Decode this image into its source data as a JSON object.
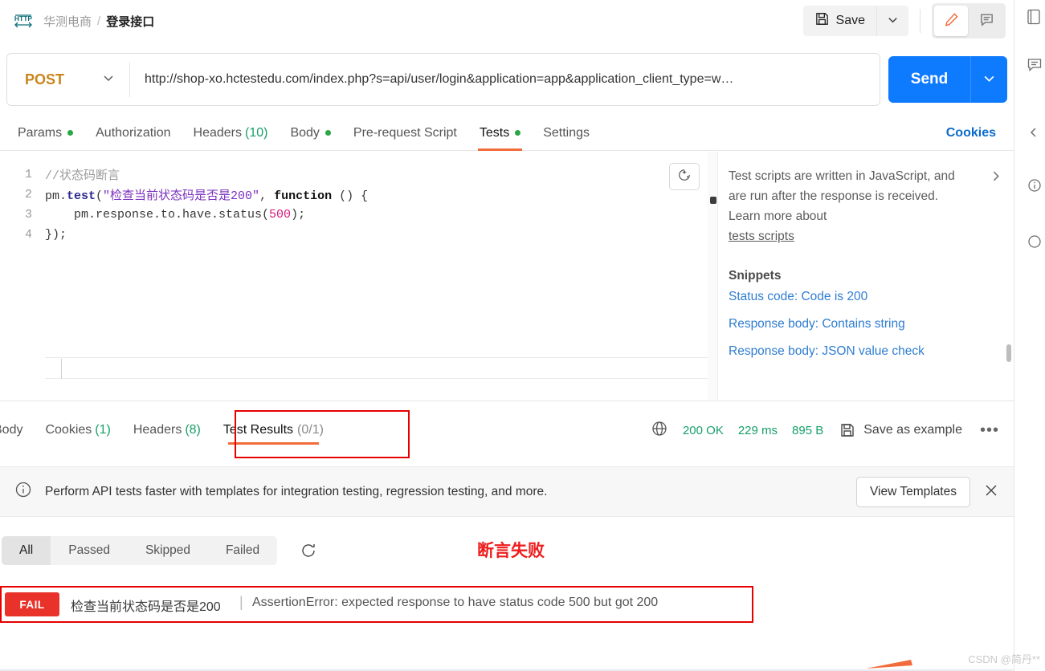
{
  "breadcrumb": {
    "protocol_badge": "HTTP",
    "parent": "华测电商",
    "separator": "/",
    "current": "登录接口"
  },
  "toolbar": {
    "save_label": "Save",
    "save_icon": "floppy-disk-icon",
    "save_caret_icon": "chevron-down-icon",
    "edit_icon": "pencil-icon",
    "comment_icon": "comment-icon"
  },
  "url_bar": {
    "method": "POST",
    "method_caret_icon": "chevron-down-icon",
    "url": "http://shop-xo.hctestedu.com/index.php?s=api/user/login&application=app&application_client_type=w…",
    "send_label": "Send",
    "send_caret_icon": "chevron-down-icon"
  },
  "request_tabs": {
    "items": [
      {
        "label": "Params",
        "dot": true,
        "count": "",
        "active": false
      },
      {
        "label": "Authorization",
        "dot": false,
        "count": "",
        "active": false
      },
      {
        "label": "Headers",
        "dot": false,
        "count": "(10)",
        "active": false
      },
      {
        "label": "Body",
        "dot": true,
        "count": "",
        "active": false
      },
      {
        "label": "Pre-request Script",
        "dot": false,
        "count": "",
        "active": false
      },
      {
        "label": "Tests",
        "dot": true,
        "count": "",
        "active": true
      },
      {
        "label": "Settings",
        "dot": false,
        "count": "",
        "active": false
      }
    ],
    "cookies_link": "Cookies"
  },
  "editor": {
    "postbot_icon": "postbot-magic-icon",
    "lines": [
      {
        "num": "1"
      },
      {
        "num": "2"
      },
      {
        "num": "3"
      },
      {
        "num": "4"
      }
    ],
    "line1_comment": "//状态码断言",
    "line2_a": "pm.",
    "line2_b": "test",
    "line2_c": "(",
    "line2_d": "\"检查当前状态码是否是200\"",
    "line2_e": ", ",
    "line2_f": "function",
    "line2_g": " () {",
    "line3_a": "    pm.response.to.have.status(",
    "line3_b": "500",
    "line3_c": ");",
    "line4": "});"
  },
  "docs": {
    "paragraph": "Test scripts are written in JavaScript, and are run after the response is received. Learn more about",
    "link": "tests scripts",
    "chevron_icon": "chevron-right-icon",
    "snippets_heading": "Snippets",
    "snippets": [
      "Status code: Code is 200",
      "Response body: Contains string",
      "Response body: JSON value check"
    ]
  },
  "response": {
    "tabs": [
      {
        "label": "Body",
        "count": "",
        "active": false
      },
      {
        "label": "Cookies",
        "count": "(1)",
        "active": false
      },
      {
        "label": "Headers",
        "count": "(8)",
        "active": false
      },
      {
        "label": "Test Results",
        "count": "(0/1)",
        "active": true
      }
    ],
    "globe_icon": "globe-icon",
    "status": "200 OK",
    "time": "229 ms",
    "size": "895 B",
    "save_example_icon": "floppy-disk-icon",
    "save_example": "Save as example",
    "more_icon": "ellipsis-icon"
  },
  "banner": {
    "info_icon": "info-circle-icon",
    "text": "Perform API tests faster with templates for integration testing, regression testing, and more.",
    "button": "View Templates",
    "close_icon": "close-icon"
  },
  "filters": {
    "items": [
      {
        "label": "All",
        "active": true
      },
      {
        "label": "Passed",
        "active": false
      },
      {
        "label": "Skipped",
        "active": false
      },
      {
        "label": "Failed",
        "active": false
      }
    ],
    "refresh_icon": "refresh-icon",
    "annotation": "断言失败"
  },
  "result_row": {
    "badge": "FAIL",
    "test_name": "检查当前状态码是否是200",
    "divider": "|",
    "message": "AssertionError: expected response to have status code 500 but got 200"
  },
  "right_rail": {
    "icons": [
      "documentation-icon",
      "comment-icon",
      "chevron-left-icon",
      "info-icon",
      "circle-icon"
    ]
  },
  "watermark": "CSDN @简丹**",
  "colors": {
    "accent_orange": "#f26b3a",
    "send_blue": "#0e7afe",
    "method_amber": "#c9851a",
    "success_green": "#17a06a",
    "fail_red": "#e8322a",
    "highlight_red": "#e60000"
  }
}
